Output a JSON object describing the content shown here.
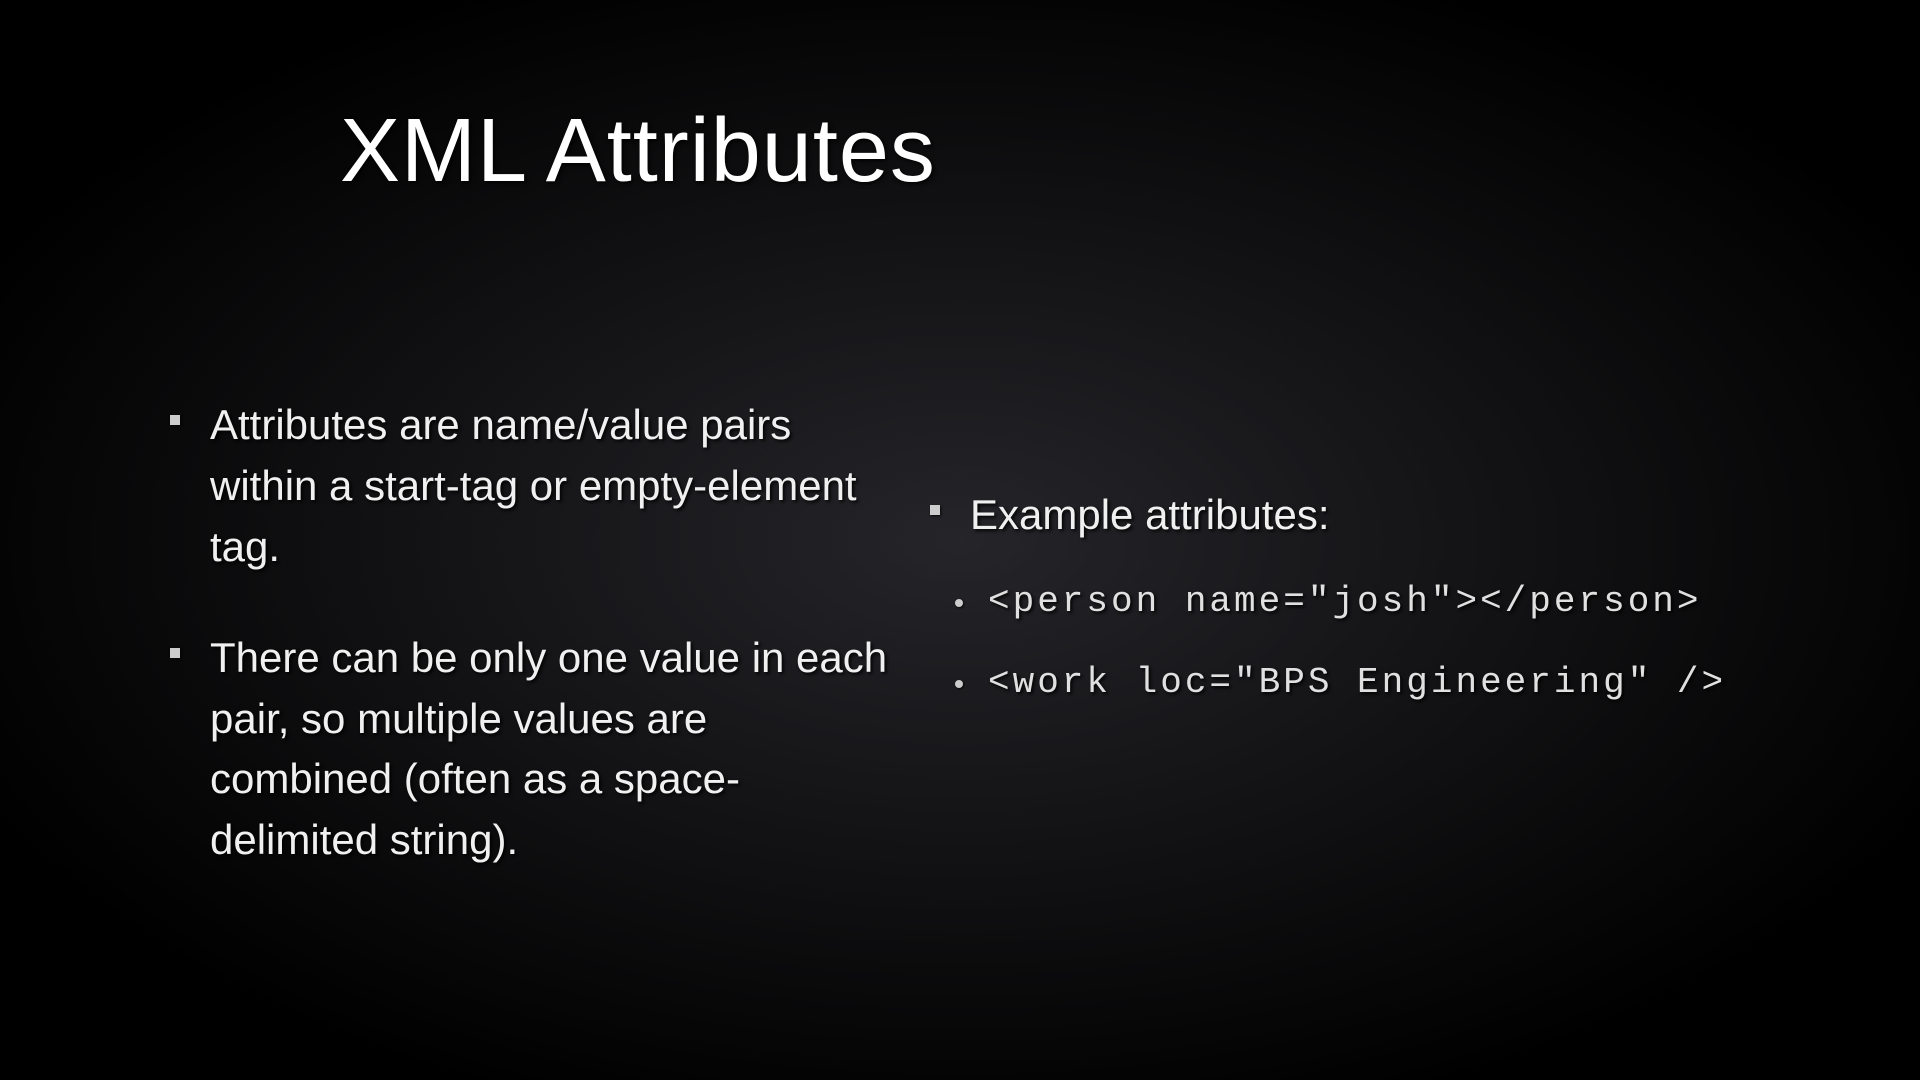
{
  "slide": {
    "title": "XML Attributes",
    "left": {
      "bullets": [
        "Attributes are name/value pairs within a start-tag or empty-element tag.",
        "There can be only one value in each pair, so multiple values are combined (often as a space-delimited string)."
      ]
    },
    "right": {
      "heading": "Example attributes:",
      "examples": [
        "<person name=\"josh\"></person>",
        "<work loc=\"BPS Engineering\" />"
      ]
    }
  }
}
